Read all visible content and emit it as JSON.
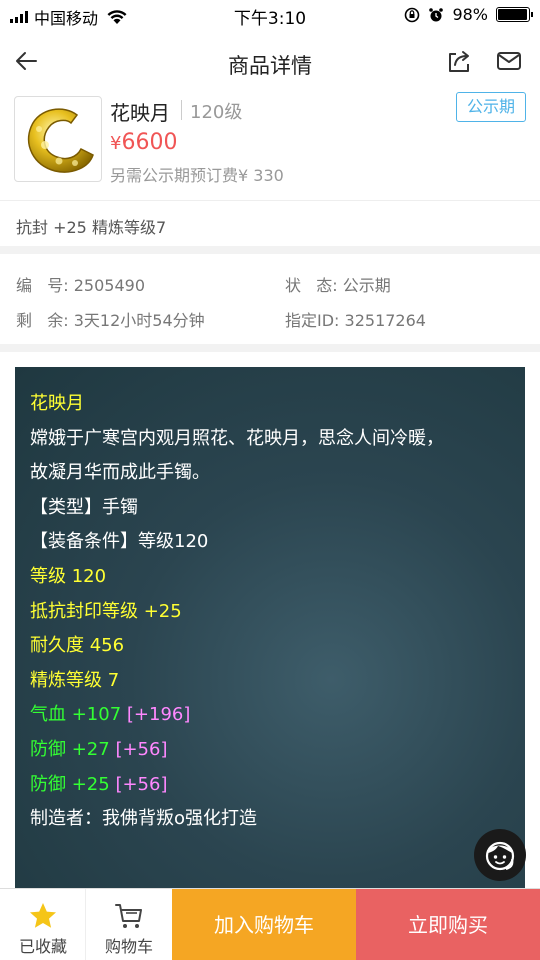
{
  "status_bar": {
    "carrier": "中国移动",
    "time": "下午3:10",
    "battery": "98%",
    "battery_level": 0.98
  },
  "nav": {
    "title": "商品详情",
    "back_icon": "back-arrow-icon",
    "share_icon": "share-icon",
    "mail_icon": "mail-icon"
  },
  "product": {
    "name": "花映月",
    "level": "120级",
    "tag": "公示期",
    "price_symbol": "¥",
    "price": "6600",
    "fee_note": "另需公示期预订费¥ 330",
    "attr": "抗封 +25 精炼等级7"
  },
  "info": {
    "number_label": "编   号: ",
    "number": "2505490",
    "status_label": "状   态: ",
    "status": "公示期",
    "remaining_label": "剩   余: ",
    "remaining": "3天12小时54分钟",
    "id_label": "指定ID: ",
    "id": "32517264"
  },
  "desc": {
    "title": "花映月",
    "story1": "嫦娥于广寒宫内观月照花、花映月，思念人间冷暖，",
    "story2": "故凝月华而成此手镯。",
    "type": "【类型】手镯",
    "requirement": "【装备条件】等级120",
    "level": "等级 120",
    "resist": "抵抗封印等级 +25",
    "durability": "耐久度 456",
    "refine": "精炼等级 7",
    "hp_base": "气血 +107 ",
    "hp_bonus": "[+196]",
    "def1_base": "防御 +27 ",
    "def1_bonus": "[+56]",
    "def2_base": "防御 +25 ",
    "def2_bonus": "[+56]",
    "maker": "制造者：我佛背叛o强化打造"
  },
  "colors": {
    "accent_red": "#f05555",
    "tag_blue": "#4fb3e8",
    "cart_orange": "#f5a623",
    "buy_red": "#e96262",
    "desc_yellow": "#ffff33",
    "desc_green": "#33ff33",
    "desc_pink": "#ff88ff"
  },
  "bottom": {
    "fav_label": "已收藏",
    "cart_label": "购物车",
    "add_label": "加入购物车",
    "buy_label": "立即购买"
  }
}
